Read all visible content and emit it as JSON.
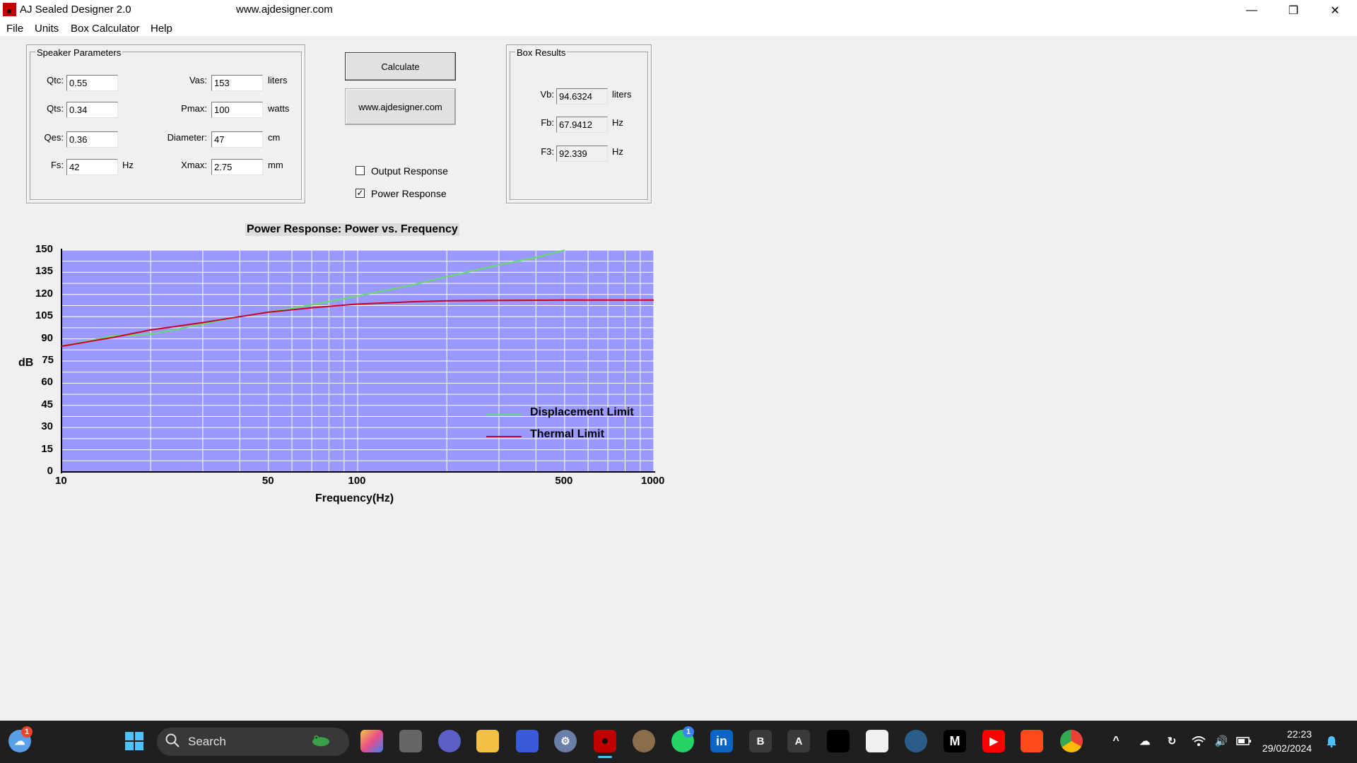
{
  "window": {
    "title": "AJ Sealed Designer 2.0",
    "url_label": "www.ajdesigner.com",
    "controls": {
      "minimize": "—",
      "restore": "❐",
      "close": "✕"
    }
  },
  "menu": [
    "File",
    "Units",
    "Box Calculator",
    "Help"
  ],
  "speaker_parameters": {
    "label": "Speaker Parameters",
    "qtc": {
      "label": "Qtc:",
      "value": "0.55"
    },
    "qts": {
      "label": "Qts:",
      "value": "0.34"
    },
    "qes": {
      "label": "Qes:",
      "value": "0.36"
    },
    "fs": {
      "label": "Fs:",
      "value": "42",
      "unit": "Hz"
    },
    "vas": {
      "label": "Vas:",
      "value": "153",
      "unit": "liters"
    },
    "pmax": {
      "label": "Pmax:",
      "value": "100",
      "unit": "watts"
    },
    "diameter": {
      "label": "Diameter:",
      "value": "47",
      "unit": "cm"
    },
    "xmax": {
      "label": "Xmax:",
      "value": "2.75",
      "unit": "mm"
    }
  },
  "buttons": {
    "calculate": "Calculate",
    "website": "www.ajdesigner.com"
  },
  "options": {
    "output_response": {
      "label": "Output Response",
      "checked": false
    },
    "power_response": {
      "label": "Power Response",
      "checked": true
    }
  },
  "box_results": {
    "label": "Box Results",
    "vb": {
      "label": "Vb:",
      "value": "94.6324",
      "unit": "liters"
    },
    "fb": {
      "label": "Fb:",
      "value": "67.9412",
      "unit": "Hz"
    },
    "f3": {
      "label": "F3:",
      "value": "92.339",
      "unit": "Hz"
    }
  },
  "chart_data": {
    "type": "line",
    "title": "Power Response: Power vs. Frequency",
    "xlabel": "Frequency(Hz)",
    "ylabel": "dB",
    "x_scale": "log",
    "xlim": [
      10,
      1000
    ],
    "ylim": [
      0,
      150
    ],
    "x_ticks": [
      "10",
      "50",
      "100",
      "500",
      "1000"
    ],
    "y_ticks": [
      "150",
      "135",
      "120",
      "105",
      "90",
      "75",
      "60",
      "45",
      "30",
      "15",
      "0"
    ],
    "grid": true,
    "background": "#9999ff",
    "legend_position": "bottom-right",
    "series": [
      {
        "name": "Displacement Limit",
        "color": "#66dd66",
        "x": [
          10,
          15,
          20,
          30,
          40,
          50,
          70,
          100,
          150,
          200,
          300,
          400,
          500
        ],
        "y": [
          85,
          92,
          93,
          100,
          105,
          108,
          113,
          119,
          126,
          132,
          140,
          145,
          150
        ]
      },
      {
        "name": "Thermal Limit",
        "color": "#cc0022",
        "x": [
          10,
          15,
          20,
          30,
          40,
          50,
          70,
          100,
          150,
          200,
          300,
          500,
          700,
          1000
        ],
        "y": [
          85,
          91,
          96,
          101,
          105,
          108,
          111,
          113.5,
          115,
          115.7,
          116,
          116.2,
          116.2,
          116.2
        ]
      }
    ]
  },
  "taskbar": {
    "search_placeholder": "Search",
    "clock_time": "22:23",
    "clock_date": "29/02/2024",
    "weather_badge": "1",
    "whatsapp_badge": "1",
    "letter_icons": {
      "b": "B",
      "a": "A",
      "m": "M"
    }
  }
}
